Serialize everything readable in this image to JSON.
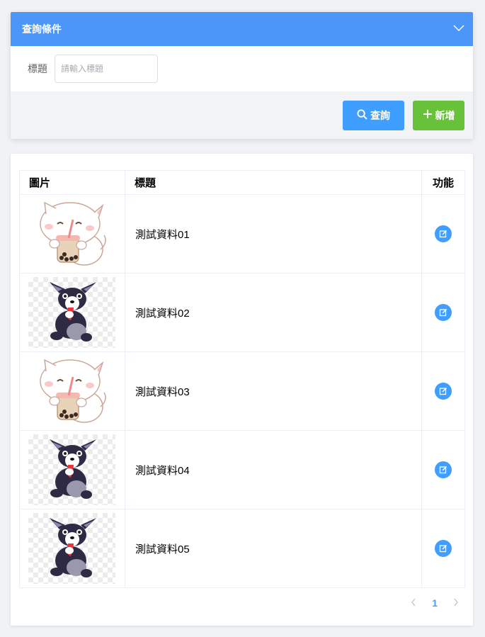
{
  "search_panel": {
    "title": "查詢條件",
    "field_label": "標題",
    "field_value": "",
    "field_placeholder": "請輸入標題",
    "search_button": "查詢",
    "add_button": "新增"
  },
  "table": {
    "columns": [
      "圖片",
      "標題",
      "功能"
    ],
    "rows": [
      {
        "title": "測試資料01",
        "image": "milk-tea-cat"
      },
      {
        "title": "測試資料02",
        "image": "husky-dog"
      },
      {
        "title": "測試資料03",
        "image": "milk-tea-cat"
      },
      {
        "title": "測試資料04",
        "image": "husky-dog"
      },
      {
        "title": "測試資料05",
        "image": "husky-dog"
      }
    ]
  },
  "pagination": {
    "current_page": "1"
  },
  "colors": {
    "header_blue": "#4b96f8",
    "primary": "#409eff",
    "success": "#67c23a"
  }
}
